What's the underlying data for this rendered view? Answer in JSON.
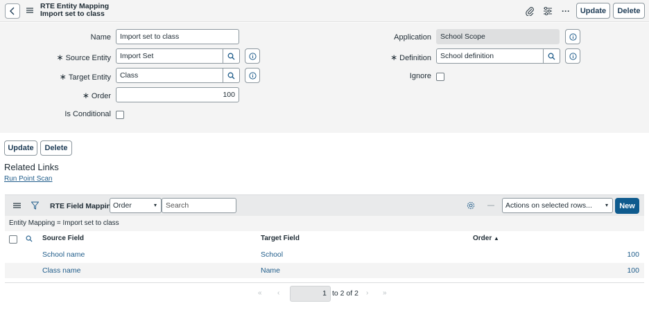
{
  "header": {
    "title_line1": "RTE Entity Mapping",
    "title_line2": "Import set to class",
    "update_label": "Update",
    "delete_label": "Delete",
    "more_label": "···"
  },
  "form": {
    "name_label": "Name",
    "name_value": "Import set to class",
    "source_entity_label": "Source Entity",
    "source_entity_value": "Import Set",
    "target_entity_label": "Target Entity",
    "target_entity_value": "Class",
    "order_label": "Order",
    "order_value": "100",
    "is_conditional_label": "Is Conditional",
    "application_label": "Application",
    "application_value": "School Scope",
    "definition_label": "Definition",
    "definition_value": "School definition",
    "ignore_label": "Ignore",
    "required_mark": "∗"
  },
  "bottom_buttons": {
    "update_label": "Update",
    "delete_label": "Delete"
  },
  "related_links": {
    "title": "Related Links",
    "link": "Run Point Scan"
  },
  "related_list": {
    "title": "RTE Field Mappings",
    "filter_field": "Order",
    "search_placeholder": "Search",
    "actions_label": "Actions on selected rows...",
    "new_label": "New",
    "breadcrumb": "Entity Mapping = Import set to class",
    "columns": [
      "Source Field",
      "Target Field",
      "Order"
    ],
    "sort_indicator": "▲",
    "rows": [
      {
        "source": "School name",
        "target": "School",
        "order": "100"
      },
      {
        "source": "Class name",
        "target": "Name",
        "order": "100"
      }
    ],
    "pager_current": "1",
    "pager_text": "to 2 of 2"
  },
  "colors": {
    "accent": "#0f5b8e",
    "link": "#1f5c8a",
    "panel_bg": "#f4f4f4"
  }
}
